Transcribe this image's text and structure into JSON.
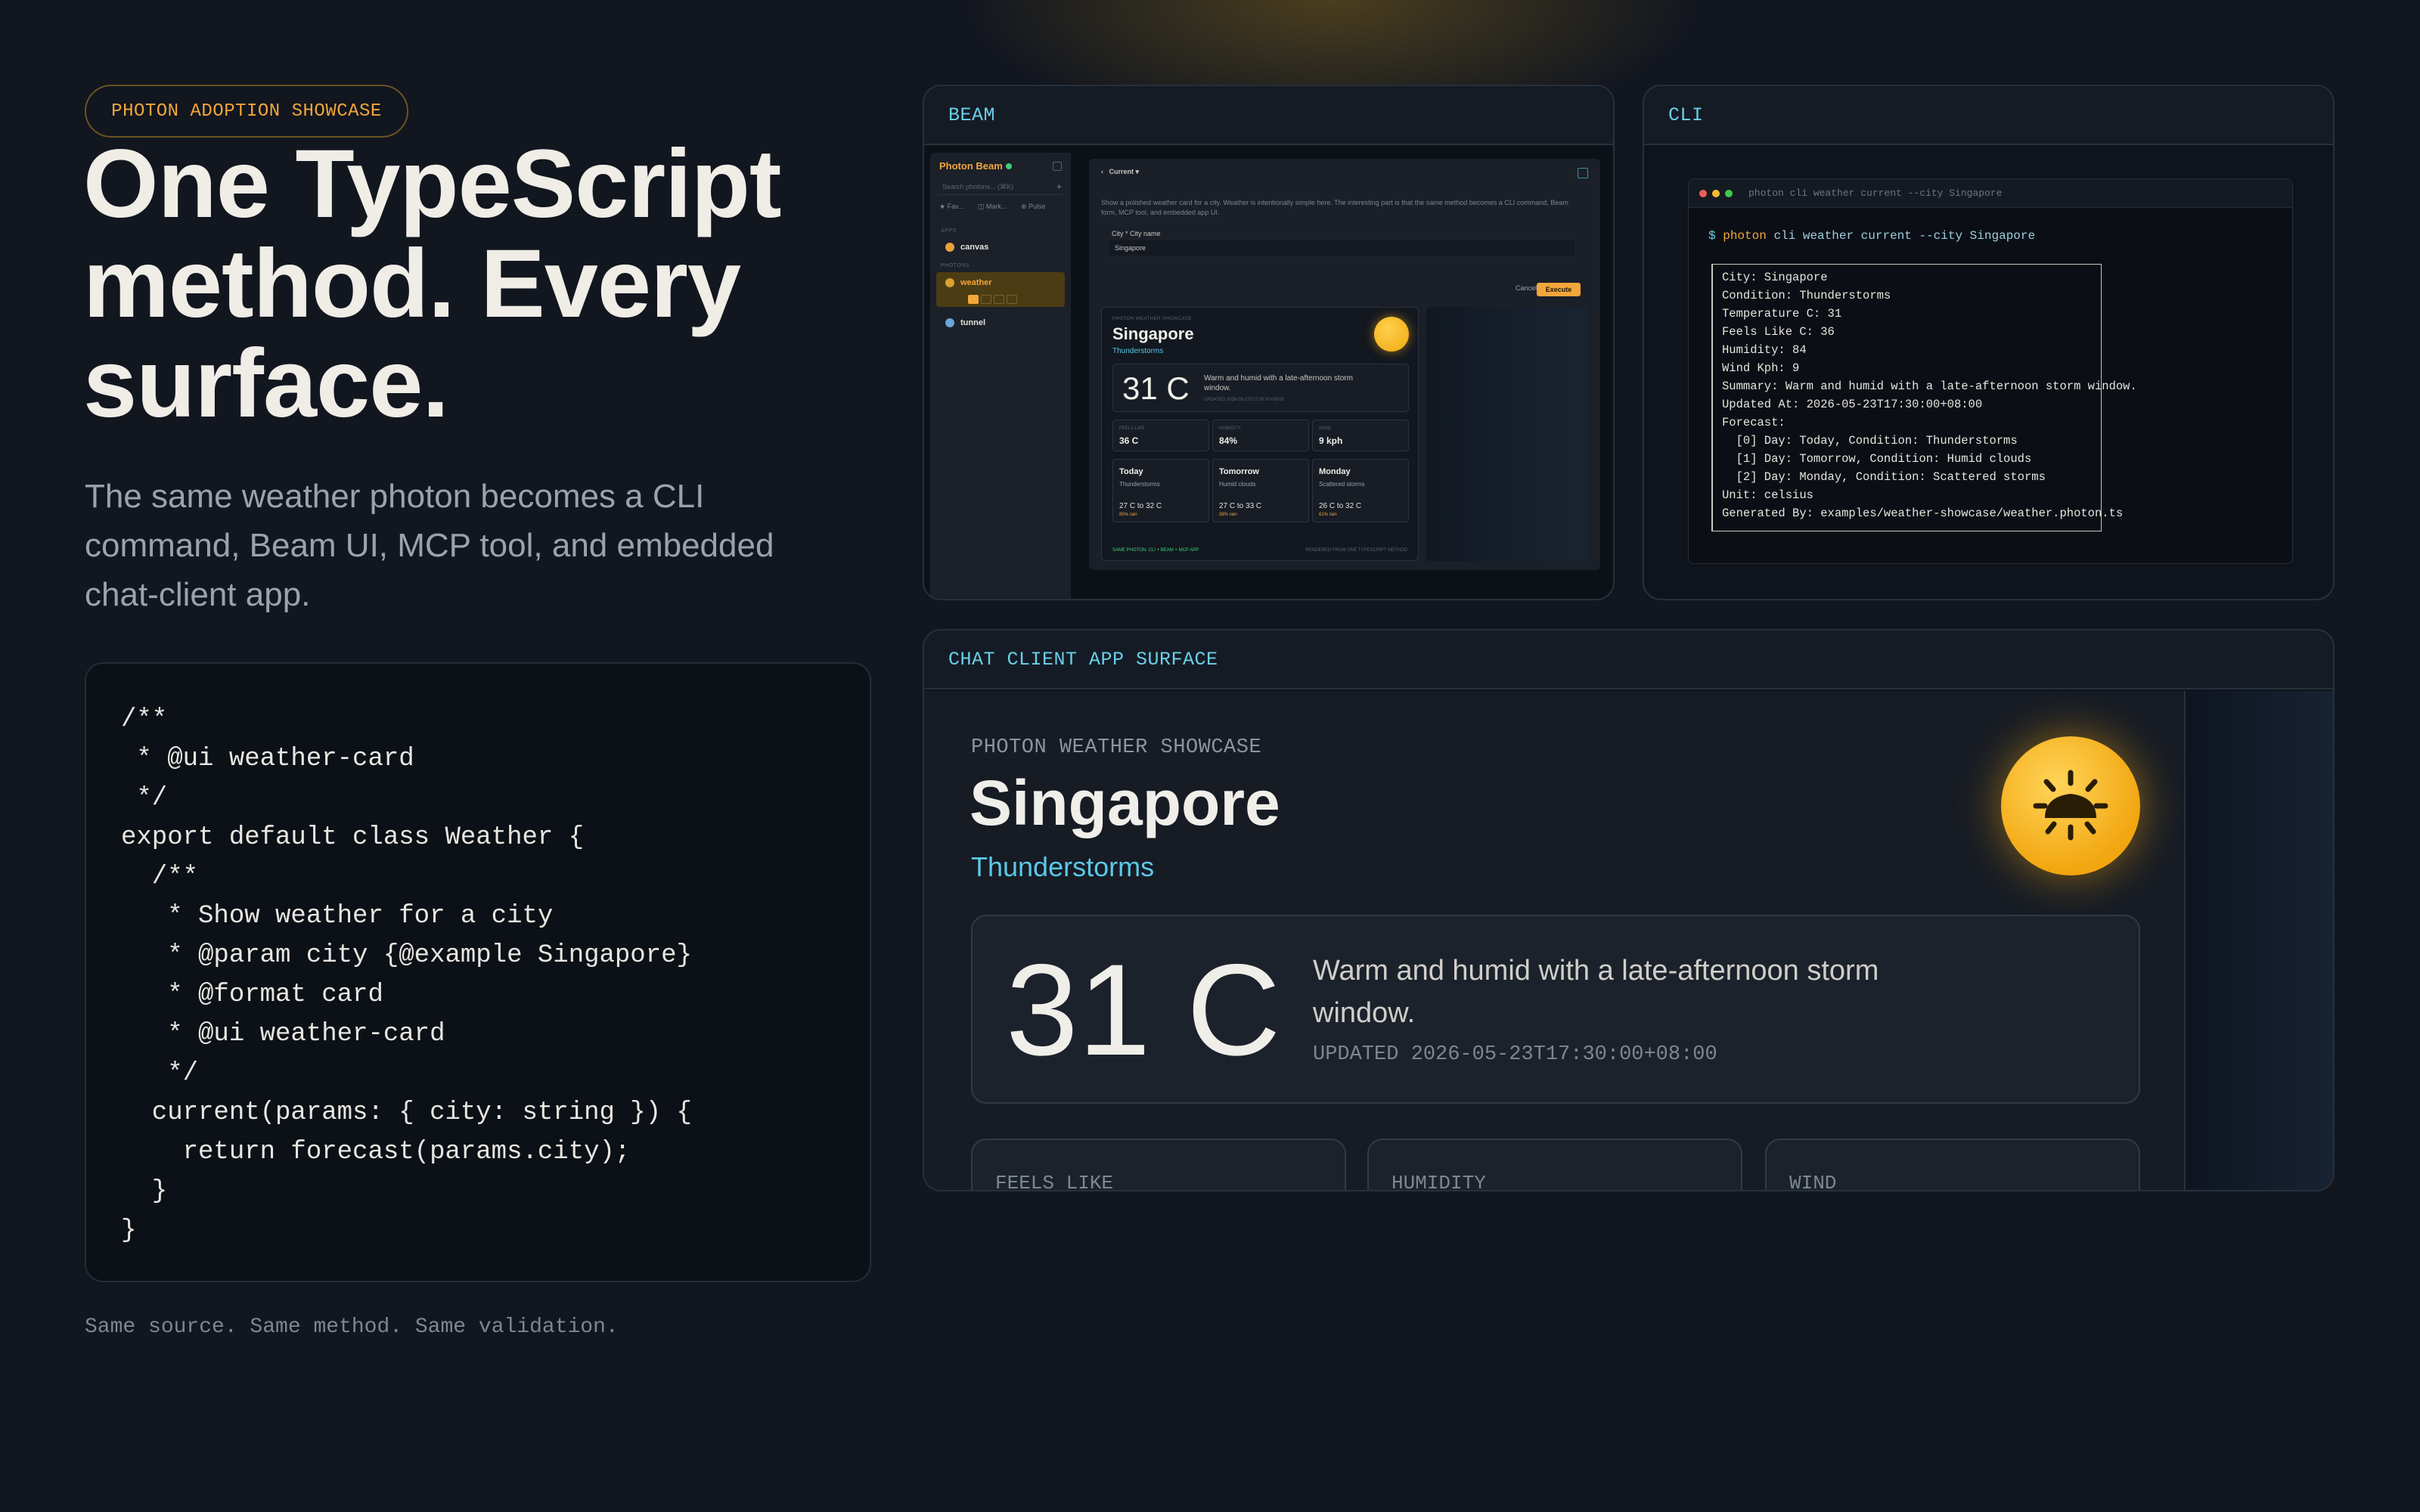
{
  "hero": {
    "eyebrow": "PHOTON ADOPTION SHOWCASE",
    "headline": "One TypeScript method. Every surface.",
    "subtitle": "The same weather photon becomes a CLI command, Beam UI, MCP tool, and embedded chat-client app.",
    "code": "/**\n * @ui weather-card\n */\nexport default class Weather {\n  /**\n   * Show weather for a city\n   * @param city {@example Singapore}\n   * @format card\n   * @ui weather-card\n   */\n  current(params: { city: string }) {\n    return forecast(params.city);\n  }\n}",
    "tagline": "Same source. Same method. Same validation."
  },
  "beam": {
    "title": "BEAM",
    "sidebar": {
      "brand": "Photon Beam",
      "search_placeholder": "Search photons... (⌘K)",
      "links": [
        "★ Fav...",
        "◫ Mark...",
        "⊕ Pulse"
      ],
      "section_apps": "APPS",
      "section_photons": "PHOTONS",
      "items": [
        "canvas",
        "weather",
        "tunnel"
      ]
    },
    "main": {
      "method": "Current",
      "description": "Show a polished weather card for a city. Weather is intentionally simple here. The interesting part is that the same method becomes a CLI command, Beam form, MCP tool, and embedded app UI.",
      "field_label": "City * City name",
      "field_value": "Singapore",
      "cancel": "Cancel",
      "execute": "Execute",
      "card": {
        "eyebrow": "PHOTON WEATHER SHOWCASE",
        "city": "Singapore",
        "condition": "Thunderstorms",
        "temp": "31 C",
        "summary": "Warm and humid with a late-afternoon storm window.",
        "updated": "UPDATED 2026-05-23T17:30:00+08:00",
        "stats": [
          {
            "label": "FEELS LIKE",
            "value": "36 C"
          },
          {
            "label": "HUMIDITY",
            "value": "84%"
          },
          {
            "label": "WIND",
            "value": "9 kph"
          }
        ],
        "forecast": [
          {
            "day": "Today",
            "condition": "Thunderstorms",
            "range": "27 C to 32 C",
            "rain": "85% rain"
          },
          {
            "day": "Tomorrow",
            "condition": "Humid clouds",
            "range": "27 C to 33 C",
            "rain": "38% rain"
          },
          {
            "day": "Monday",
            "condition": "Scattered storms",
            "range": "26 C to 32 C",
            "rain": "61% rain"
          }
        ],
        "footer_left": "SAME PHOTON: CLI + BEAM + MCP APP",
        "footer_right": "RENDERED FROM ONE TYPESCRIPT METHOD"
      }
    }
  },
  "cli": {
    "title": "CLI",
    "window_title": "photon cli weather current --city Singapore",
    "prompt": "$",
    "command_keyword": "photon",
    "command_rest": "cli weather current --city Singapore",
    "output": "City: Singapore\nCondition: Thunderstorms\nTemperature C: 31\nFeels Like C: 36\nHumidity: 84\nWind Kph: 9\nSummary: Warm and humid with a late-afternoon storm window.\nUpdated At: 2026-05-23T17:30:00+08:00\nForecast:\n  [0] Day: Today, Condition: Thunderstorms\n  [1] Day: Tomorrow, Condition: Humid clouds\n  [2] Day: Monday, Condition: Scattered storms\nUnit: celsius\nGenerated By: examples/weather-showcase/weather.photon.ts"
  },
  "chat": {
    "title": "CHAT CLIENT APP SURFACE",
    "eyebrow": "PHOTON WEATHER SHOWCASE",
    "city": "Singapore",
    "condition": "Thunderstorms",
    "temp": "31 C",
    "summary": "Warm and humid with a late-afternoon storm window.",
    "updated": "UPDATED 2026-05-23T17:30:00+08:00",
    "stats": [
      "FEELS LIKE",
      "HUMIDITY",
      "WIND"
    ]
  },
  "colors": {
    "accent": "#f3a63a",
    "cyan": "#6ad0e8",
    "background": "#12161f"
  }
}
